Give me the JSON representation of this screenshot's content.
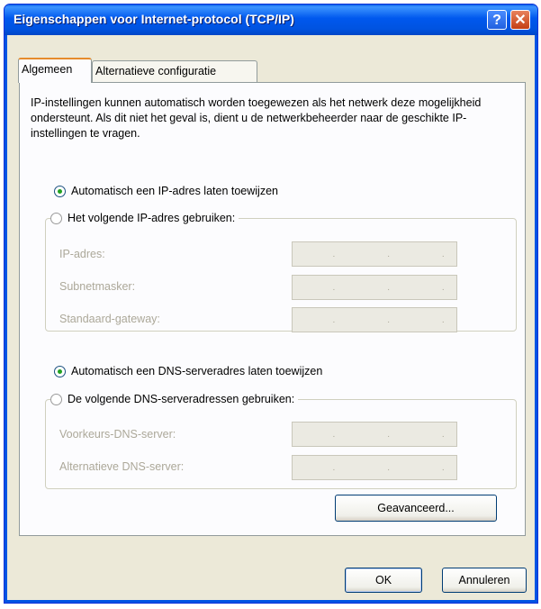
{
  "window": {
    "title": "Eigenschappen voor Internet-protocol (TCP/IP)",
    "help_label": "?",
    "close_label": "✕"
  },
  "tabs": [
    {
      "label": "Algemeen",
      "active": true
    },
    {
      "label": "Alternatieve configuratie",
      "active": false
    }
  ],
  "intro_text": "IP-instellingen kunnen automatisch worden toegewezen als het netwerk deze mogelijkheid ondersteunt. Als dit niet het geval is, dient u de netwerkbeheerder naar de geschikte IP-instellingen te vragen.",
  "ip": {
    "auto_label": "Automatisch een IP-adres laten toewijzen",
    "manual_label": "Het volgende IP-adres gebruiken:",
    "selected": "auto",
    "fields": [
      {
        "label": "IP-adres:",
        "value": ". . ."
      },
      {
        "label": "Subnetmasker:",
        "value": ". . ."
      },
      {
        "label": "Standaard-gateway:",
        "value": ". . ."
      }
    ]
  },
  "dns": {
    "auto_label": "Automatisch een DNS-serveradres laten toewijzen",
    "manual_label": "De volgende DNS-serveradressen gebruiken:",
    "selected": "auto",
    "fields": [
      {
        "label": "Voorkeurs-DNS-server:",
        "value": ". . ."
      },
      {
        "label": "Alternatieve DNS-server:",
        "value": ". . ."
      }
    ]
  },
  "buttons": {
    "advanced": "Geavanceerd...",
    "ok": "OK",
    "cancel": "Annuleren"
  },
  "colors": {
    "titlebar": "#0058ee",
    "dialog_bg": "#ece9d8",
    "radio_selected": "#21a121",
    "disabled_text": "#aca899"
  }
}
